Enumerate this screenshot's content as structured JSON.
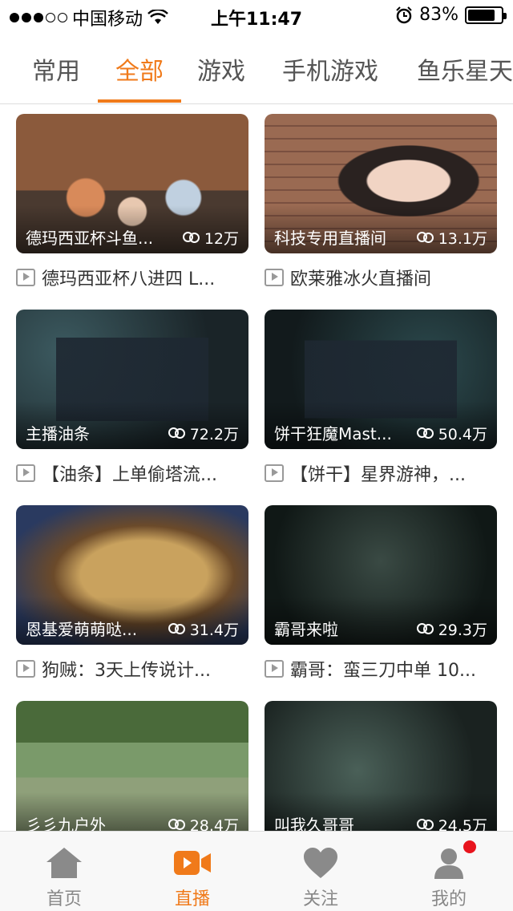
{
  "status_bar": {
    "carrier": "中国移动",
    "time": "上午11:47",
    "battery_text": "83%",
    "battery_level": 0.83,
    "signal_bars_filled": 3,
    "signal_bars_total": 5
  },
  "tabs": [
    {
      "label": "常用"
    },
    {
      "label": "全部",
      "active": true
    },
    {
      "label": "游戏"
    },
    {
      "label": "手机游戏"
    },
    {
      "label": "鱼乐星天"
    }
  ],
  "cards": [
    {
      "anchor": "德玛西亚杯斗鱼...",
      "viewers": "12万",
      "title": "德玛西亚杯八进四 L..."
    },
    {
      "anchor": "科技专用直播间",
      "viewers": "13.1万",
      "title": "欧莱雅冰火直播间"
    },
    {
      "anchor": "主播油条",
      "viewers": "72.2万",
      "title": "【油条】上单偷塔流..."
    },
    {
      "anchor": "饼干狂魔Mast...",
      "viewers": "50.4万",
      "title": "【饼干】星界游神，..."
    },
    {
      "anchor": "恩基爱萌萌哒...",
      "viewers": "31.4万",
      "title": "狗贼：3天上传说计..."
    },
    {
      "anchor": "霸哥来啦",
      "viewers": "29.3万",
      "title": "霸哥：蛮三刀中单 10..."
    },
    {
      "anchor": "彡彡九户外",
      "viewers": "28.4万",
      "title": ""
    },
    {
      "anchor": "叫我久哥哥",
      "viewers": "24.5万",
      "title": ""
    }
  ],
  "bottom_nav": [
    {
      "label": "首页",
      "icon": "home-icon"
    },
    {
      "label": "直播",
      "icon": "video-camera-icon",
      "active": true
    },
    {
      "label": "关注",
      "icon": "heart-icon"
    },
    {
      "label": "我的",
      "icon": "user-icon",
      "has_badge": true
    }
  ],
  "colors": {
    "accent": "#f07a1a",
    "badge": "#e8141d"
  }
}
